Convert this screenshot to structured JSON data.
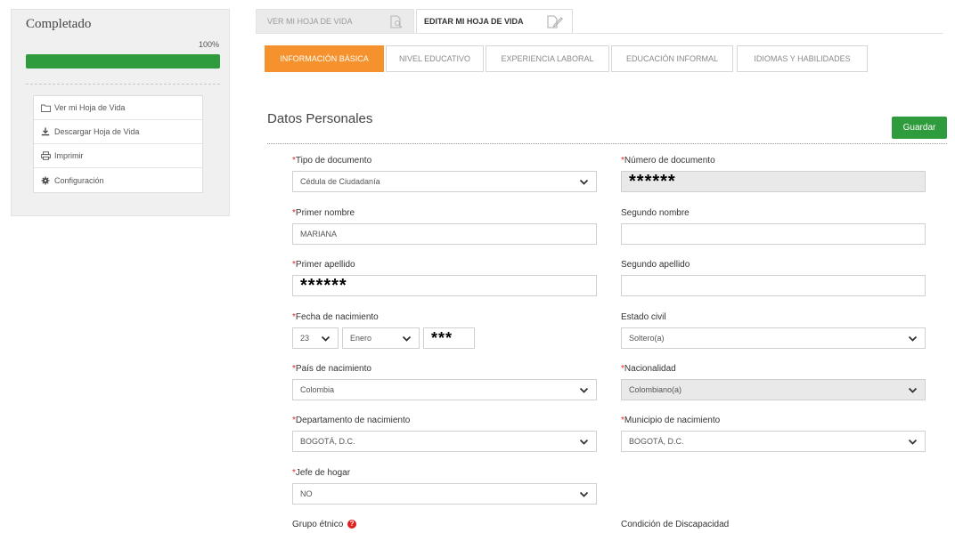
{
  "sidebar": {
    "title": "Completado",
    "progress_label": "100%",
    "progress_value": 1.0,
    "menu": [
      {
        "label": "Ver mi Hoja de Vida",
        "icon": "folder-open-icon"
      },
      {
        "label": "Descargar Hoja de Vida",
        "icon": "download-icon"
      },
      {
        "label": "Imprimir",
        "icon": "print-icon"
      },
      {
        "label": "Configuración",
        "icon": "gear-icon"
      }
    ]
  },
  "top_tabs": [
    {
      "label": "VER MI HOJA DE VIDA",
      "icon": "search-document-icon",
      "active": false
    },
    {
      "label": "EDITAR MI HOJA DE VIDA",
      "icon": "edit-document-icon",
      "active": true
    }
  ],
  "section_tabs": [
    {
      "label": "INFORMACIÓN BÁSICA",
      "active": true
    },
    {
      "label": "NIVEL EDUCATIVO",
      "active": false
    },
    {
      "label": "EXPERIENCIA LABORAL",
      "active": false
    },
    {
      "label": "EDUCACIÓN INFORMAL",
      "active": false
    },
    {
      "label": "IDIOMAS Y HABILIDADES",
      "active": false
    }
  ],
  "section": {
    "title": "Datos Personales",
    "save_label": "Guardar"
  },
  "form": {
    "required_mark": "*",
    "tipo_documento": {
      "label": "Tipo de documento",
      "value": "Cédula de Ciudadanía"
    },
    "numero_documento": {
      "label": "Número de documento",
      "value": "******"
    },
    "primer_nombre": {
      "label": "Primer nombre",
      "value": "MARIANA"
    },
    "segundo_nombre": {
      "label": "Segundo nombre",
      "value": ""
    },
    "primer_apellido": {
      "label": "Primer apellido",
      "value": "******"
    },
    "segundo_apellido": {
      "label": "Segundo apellido",
      "value": ""
    },
    "fecha_nacimiento": {
      "label": "Fecha de nacimiento",
      "day": "23",
      "month": "Enero",
      "year": "***"
    },
    "estado_civil": {
      "label": "Estado civil",
      "value": "Soltero(a)"
    },
    "pais_nacimiento": {
      "label": "País de nacimiento",
      "value": "Colombia"
    },
    "nacionalidad": {
      "label": "Nacionalidad",
      "value": "Colombiano(a)"
    },
    "departamento_nacimiento": {
      "label": "Departamento de nacimiento",
      "value": "BOGOTÁ, D.C."
    },
    "municipio_nacimiento": {
      "label": "Municipio de nacimiento",
      "value": "BOGOTÁ, D.C."
    },
    "jefe_hogar": {
      "label": "Jefe de hogar",
      "value": "NO"
    },
    "grupo_etnico": {
      "label": "Grupo étnico"
    },
    "condicion_discapacidad": {
      "label": "Condición de Discapacidad"
    }
  },
  "colors": {
    "accent_orange": "#f6922d",
    "success_green": "#2e9b3c",
    "required_red": "#e22222"
  }
}
